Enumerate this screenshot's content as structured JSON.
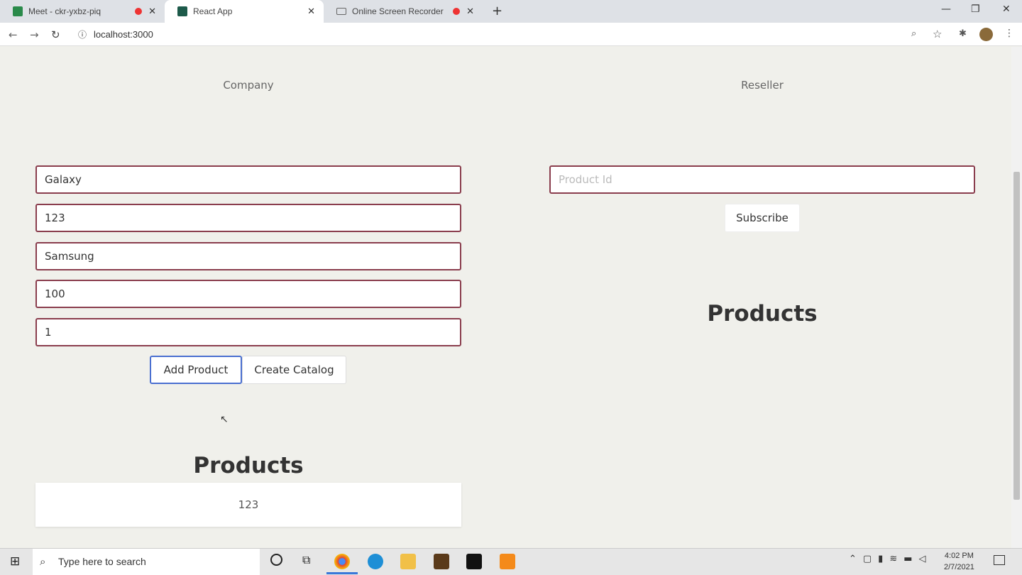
{
  "browser": {
    "tabs": [
      {
        "title": "Meet - ckr-yxbz-piq",
        "recording": true
      },
      {
        "title": "React App",
        "active": true
      },
      {
        "title": "Online Screen Recorder",
        "recording": true
      }
    ],
    "url": "localhost:3000"
  },
  "company": {
    "header": "Company",
    "fields": [
      "Galaxy",
      "123",
      "Samsung",
      "100",
      "1"
    ],
    "add_button": "Add Product",
    "catalog_button": "Create Catalog",
    "products_title": "Products",
    "products": [
      "123"
    ]
  },
  "reseller": {
    "header": "Reseller",
    "product_id_placeholder": "Product Id",
    "subscribe_button": "Subscribe",
    "products_title": "Products"
  },
  "taskbar": {
    "search_placeholder": "Type here to search",
    "time": "4:02 PM",
    "date": "2/7/2021"
  }
}
